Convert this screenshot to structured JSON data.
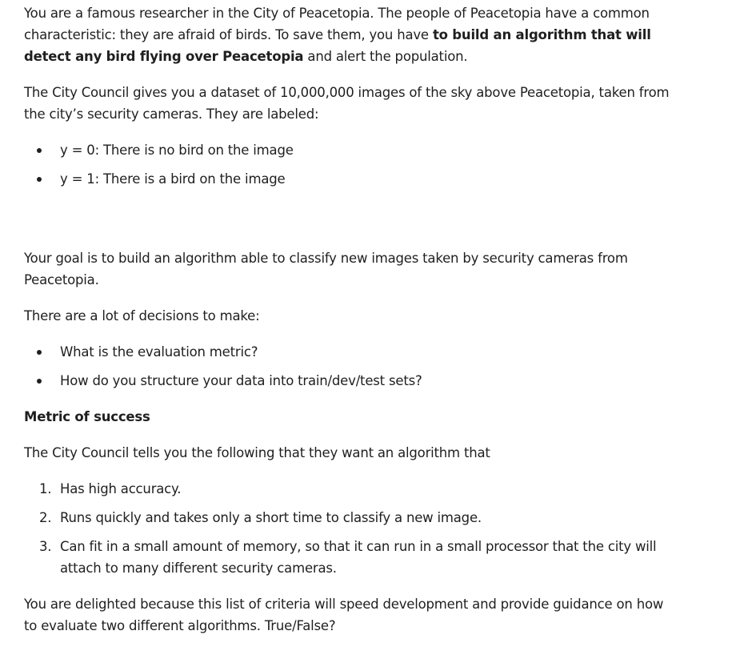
{
  "intro": {
    "text_start": "You are a famous researcher in the City of Peacetopia. The people of Peacetopia have a common characteristic: they are afraid of birds. To save them, you have ",
    "bold": "to build an algorithm that will detect any bird flying over Peacetopia",
    "text_end": " and alert the population."
  },
  "dataset_paragraph": "The City Council gives you a dataset of 10,000,000 images of the sky above Peacetopia, taken from the city’s security cameras. They are labeled:",
  "labels": [
    "y = 0: There is no bird on the image",
    "y = 1: There is a bird on the image"
  ],
  "goal_paragraph": "Your goal is to build an algorithm able to classify new images taken by security cameras from Peacetopia.",
  "decisions_paragraph": "There are a lot of decisions to make:",
  "decisions": [
    "What is the evaluation metric?",
    "How do you structure your data into train/dev/test sets?"
  ],
  "metric_heading": "Metric of success",
  "council_paragraph": "The City Council tells you the following that they want an algorithm that",
  "criteria": [
    {
      "marker": "1.",
      "text": "Has high accuracy."
    },
    {
      "marker": "2.",
      "text": "Runs quickly and takes only a short time to classify a new image."
    },
    {
      "marker": "3.",
      "text": "Can fit in a small amount of memory, so that it can run in a small processor that the city will attach to many different security cameras."
    }
  ],
  "question_paragraph": "You are delighted because this list of criteria will speed development and provide guidance on how to evaluate two different algorithms. True/False?"
}
